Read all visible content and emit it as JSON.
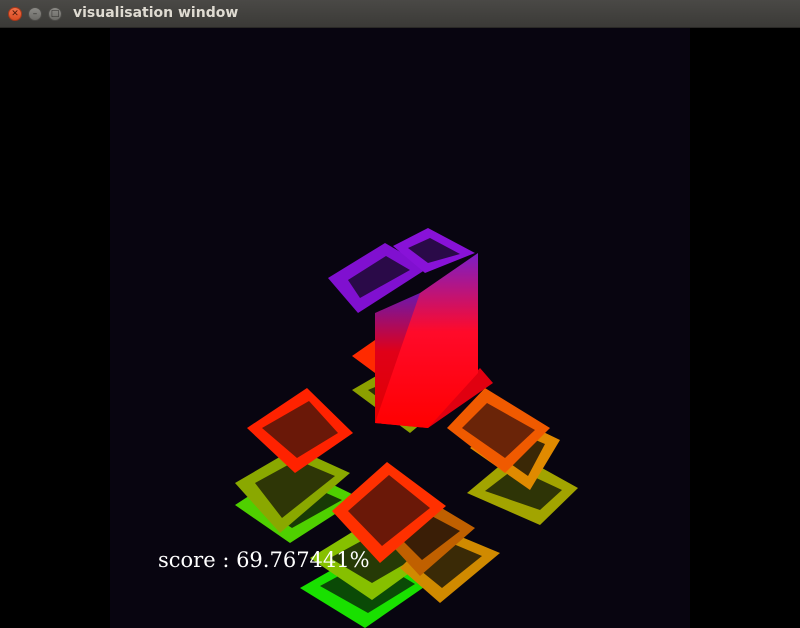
{
  "window": {
    "title": "visualisation window",
    "close_icon": "close-icon",
    "minimize_icon": "minimize-icon",
    "maximize_icon": "maximize-icon"
  },
  "scene": {
    "background": "#080510",
    "score_text": "score : 69.767441%"
  }
}
